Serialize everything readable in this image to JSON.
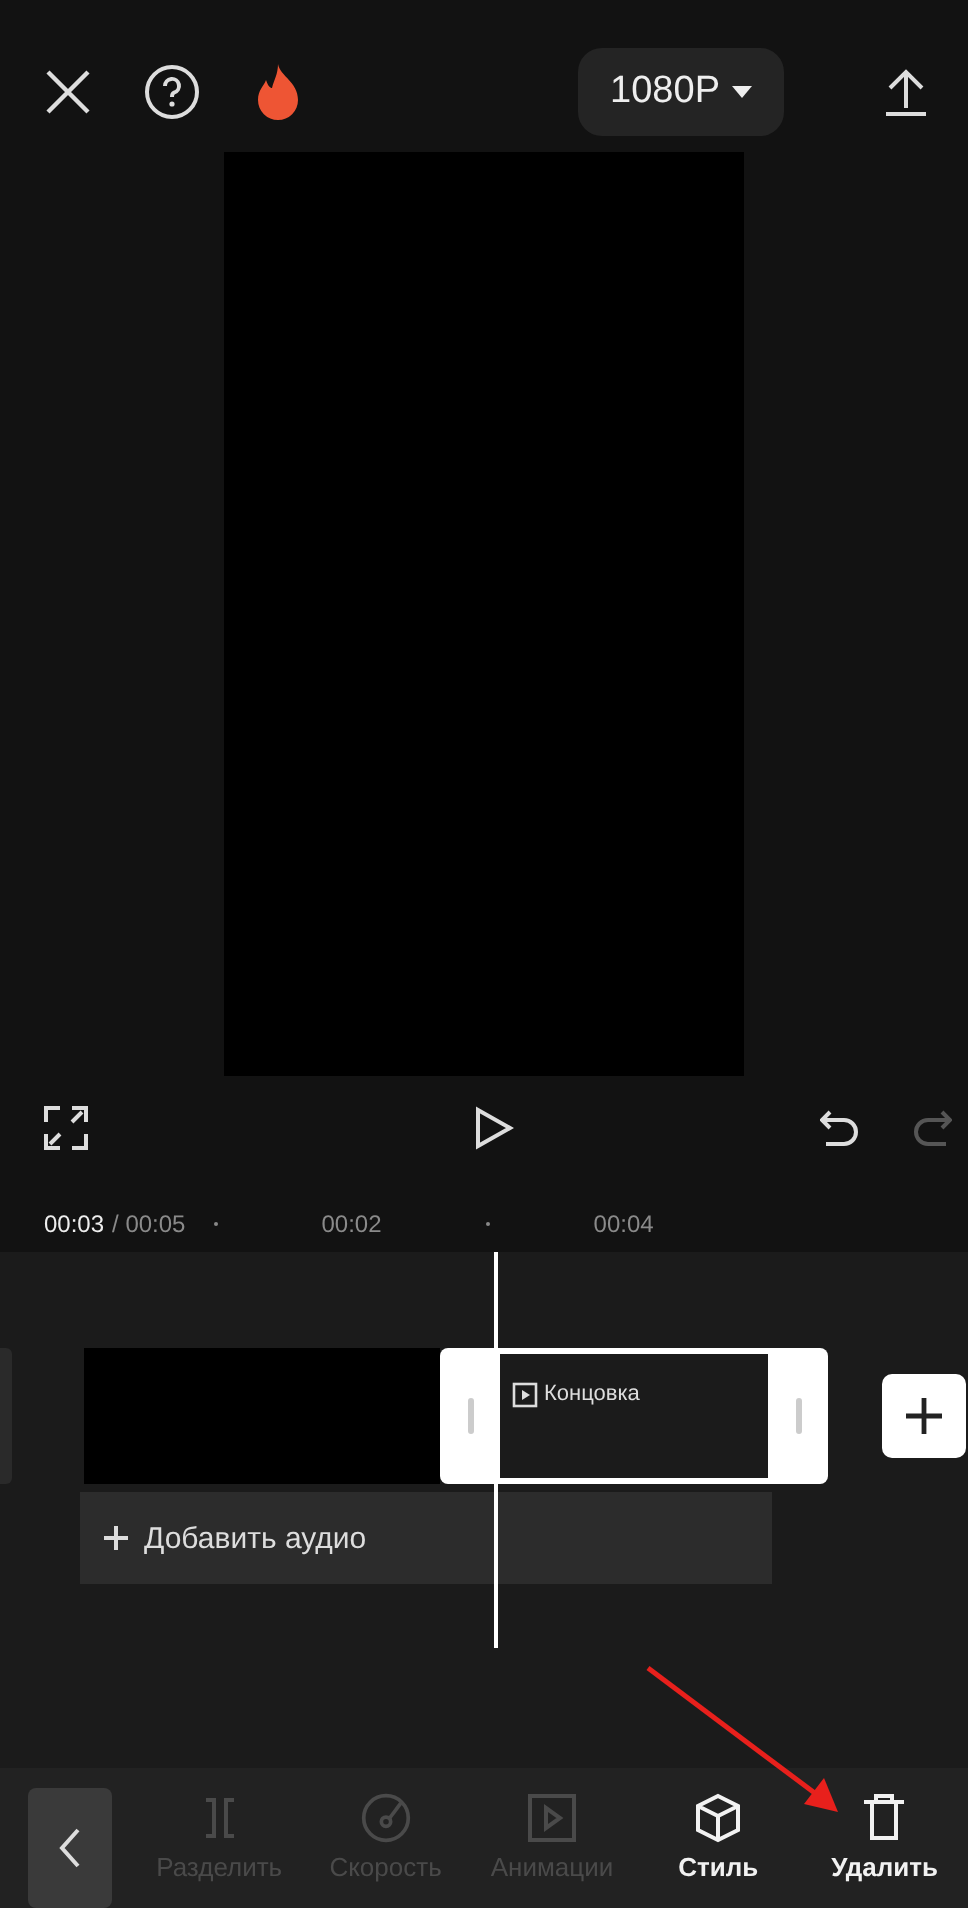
{
  "top_bar": {
    "resolution": "1080P"
  },
  "timecode": {
    "current": "00:03",
    "total": "/ 00:05"
  },
  "ruler": {
    "ticks": [
      "00:02",
      "00:04"
    ]
  },
  "timeline": {
    "clips": [
      {
        "kind": "plain",
        "selected": false
      },
      {
        "kind": "end",
        "selected": true,
        "label": "Концовка"
      }
    ],
    "add_audio": "Добавить аудио"
  },
  "toolbar": {
    "tools": [
      {
        "kind": "split",
        "label": "Разделить",
        "disabled": true
      },
      {
        "kind": "speed",
        "label": "Скорость",
        "disabled": true
      },
      {
        "kind": "animation",
        "label": "Анимации",
        "disabled": true
      },
      {
        "kind": "style",
        "label": "Стиль",
        "disabled": false
      },
      {
        "kind": "delete",
        "label": "Удалить",
        "disabled": false
      }
    ]
  }
}
